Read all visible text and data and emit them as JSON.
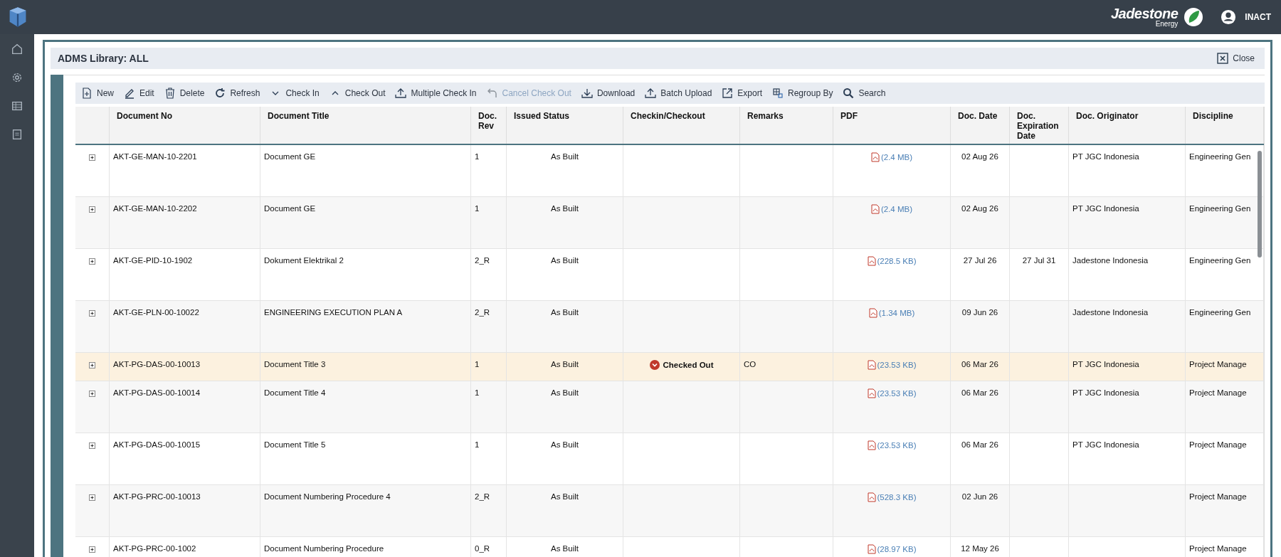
{
  "header": {
    "brand": "Jadestone",
    "brand_sub": "Energy",
    "user": "INACT"
  },
  "panel": {
    "title": "ADMS Library: ALL",
    "close": "Close"
  },
  "toolbar": [
    {
      "label": "New",
      "kind": "new",
      "disabled": false
    },
    {
      "label": "Edit",
      "kind": "edit",
      "disabled": false
    },
    {
      "label": "Delete",
      "kind": "delete",
      "disabled": false
    },
    {
      "label": "Refresh",
      "kind": "refresh",
      "disabled": false
    },
    {
      "label": "Check In",
      "kind": "down",
      "disabled": false
    },
    {
      "label": "Check Out",
      "kind": "up",
      "disabled": false
    },
    {
      "label": "Multiple Check In",
      "kind": "upload",
      "disabled": false
    },
    {
      "label": "Cancel Check Out",
      "kind": "undo",
      "disabled": true
    },
    {
      "label": "Download",
      "kind": "download",
      "disabled": false
    },
    {
      "label": "Batch Upload",
      "kind": "upload",
      "disabled": false
    },
    {
      "label": "Export",
      "kind": "export",
      "disabled": false
    },
    {
      "label": "Regroup By",
      "kind": "regroup",
      "disabled": false
    },
    {
      "label": "Search",
      "kind": "search",
      "disabled": false
    }
  ],
  "table": {
    "columns": [
      "Document No",
      "Document Title",
      "Doc. Rev",
      "Issued Status",
      "Checkin/Checkout",
      "Remarks",
      "PDF",
      "Doc. Date",
      "Doc. Expiration Date",
      "Doc. Originator",
      "Discipline"
    ],
    "rows": [
      {
        "doc_no": "AKT-GE-MAN-10-2201",
        "title": "Document GE",
        "rev": "1",
        "status": "As Built",
        "checked_out": false,
        "pdf": "(2.4 MB)",
        "date": "02 Aug 26",
        "originator": "PT JGC Indonesia",
        "discipline": "Engineering Gen"
      },
      {
        "doc_no": "AKT-GE-MAN-10-2202",
        "title": "Document GE",
        "rev": "1",
        "status": "As Built",
        "checked_out": false,
        "pdf": "(2.4 MB)",
        "date": "02 Aug 26",
        "originator": "PT JGC Indonesia",
        "discipline": "Engineering Gen"
      },
      {
        "doc_no": "AKT-GE-PID-10-1902",
        "title": "Dokument Elektrikal 2",
        "rev": "2_R",
        "status": "As Built",
        "checked_out": false,
        "pdf": "(228.5 KB)",
        "date": "27 Jul 26",
        "expiration": "27 Jul 31",
        "originator": "Jadestone Indonesia",
        "discipline": "Engineering Gen"
      },
      {
        "doc_no": "AKT-GE-PLN-00-10022",
        "title": "ENGINEERING EXECUTION PLAN A",
        "rev": "2_R",
        "status": "As Built",
        "checked_out": false,
        "pdf": "(1.34 MB)",
        "date": "09 Jun 26",
        "originator": "Jadestone Indonesia",
        "discipline": "Engineering Gen"
      },
      {
        "doc_no": "AKT-PG-DAS-00-10013",
        "title": "Document Title 3",
        "rev": "1",
        "status": "As Built",
        "checked_out": true,
        "checkout_label": "Checked Out",
        "remarks": "CO",
        "pdf": "(23.53 KB)",
        "date": "06 Mar 26",
        "originator": "PT JGC Indonesia",
        "discipline": "Project Manage"
      },
      {
        "doc_no": "AKT-PG-DAS-00-10014",
        "title": "Document Title 4",
        "rev": "1",
        "status": "As Built",
        "checked_out": false,
        "pdf": "(23.53 KB)",
        "date": "06 Mar 26",
        "originator": "PT JGC Indonesia",
        "discipline": "Project Manage"
      },
      {
        "doc_no": "AKT-PG-DAS-00-10015",
        "title": "Document Title 5",
        "rev": "1",
        "status": "As Built",
        "checked_out": false,
        "pdf": "(23.53 KB)",
        "date": "06 Mar 26",
        "originator": "PT JGC Indonesia",
        "discipline": "Project Manage"
      },
      {
        "doc_no": "AKT-PG-PRC-00-10013",
        "title": "Document Numbering Procedure 4",
        "rev": "2_R",
        "status": "As Built",
        "checked_out": false,
        "pdf": "(528.3 KB)",
        "date": "02 Jun 26",
        "discipline": "Project Manage"
      },
      {
        "doc_no": "AKT-PG-PRC-00-1002",
        "title": "Document Numbering Procedure",
        "rev": "0_R",
        "status": "As Built",
        "checked_out": false,
        "pdf": "(28.97 KB)",
        "date": "12 May 26",
        "discipline": "Project Manage"
      }
    ]
  }
}
